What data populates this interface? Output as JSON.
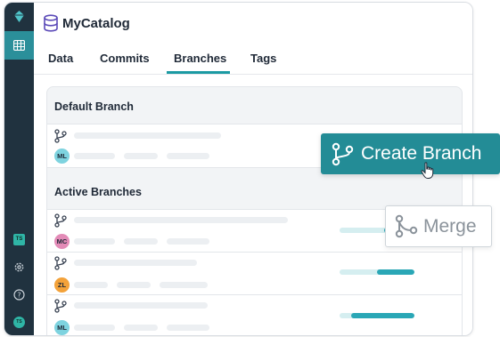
{
  "header": {
    "title": "MyCatalog"
  },
  "tabs": [
    {
      "label": "Data"
    },
    {
      "label": "Commits"
    },
    {
      "label": "Branches"
    },
    {
      "label": "Tags"
    }
  ],
  "active_tab": "Branches",
  "sections": {
    "default": {
      "title": "Default Branch",
      "avatar": "ML"
    },
    "active": {
      "title": "Active Branches",
      "rows": [
        {
          "avatar": "MC",
          "avatar_color": "#e38bb7",
          "progress": 0.4
        },
        {
          "avatar": "ZL",
          "avatar_color": "#f3a23a",
          "progress": 0.5
        },
        {
          "avatar": "ML",
          "avatar_color": "#7ed3df",
          "progress": 0.85
        }
      ]
    }
  },
  "sidebar": {
    "badge": "TS",
    "user_initials": "TS"
  },
  "actions": {
    "create_branch": "Create Branch",
    "merge": "Merge"
  },
  "colors": {
    "accent": "#238c96",
    "rail": "#20323f"
  }
}
